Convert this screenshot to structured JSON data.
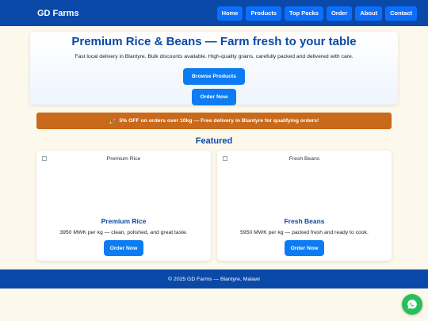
{
  "header": {
    "brand": "GD Farms",
    "nav": [
      "Home",
      "Products",
      "Top Packs",
      "Order",
      "About",
      "Contact"
    ]
  },
  "hero": {
    "title": "Premium Rice & Beans — Farm fresh to your table",
    "subtitle": "Fast local delivery in Blantyre. Bulk discounts available. High-quality grains, carefully packed and delivered with care.",
    "browse_label": "Browse Products",
    "order_label": "Order Now"
  },
  "promo": {
    "icon": "party-popper-icon",
    "text": "5% OFF on orders over 10kg — Free delivery in Blantyre for qualifying orders!"
  },
  "featured": {
    "title": "Featured",
    "products": [
      {
        "image_alt": "Premium Rice",
        "name": "Premium Rice",
        "description": "3950 MWK per kg — clean, polished, and great taste.",
        "button": "Order Now"
      },
      {
        "image_alt": "Fresh Beans",
        "name": "Fresh Beans",
        "description": "5950 MWK per kg — packed fresh and ready to cook.",
        "button": "Order Now"
      }
    ]
  },
  "footer": {
    "text": "© 2025 GD Farms — Blantyre, Malawi"
  },
  "chat": {
    "icon": "whatsapp-icon"
  },
  "colors": {
    "primary": "#0b49a8",
    "button": "#0d7cf2",
    "promo": "#c8691c",
    "background": "#fdf8ec",
    "chat": "#25c05a"
  }
}
